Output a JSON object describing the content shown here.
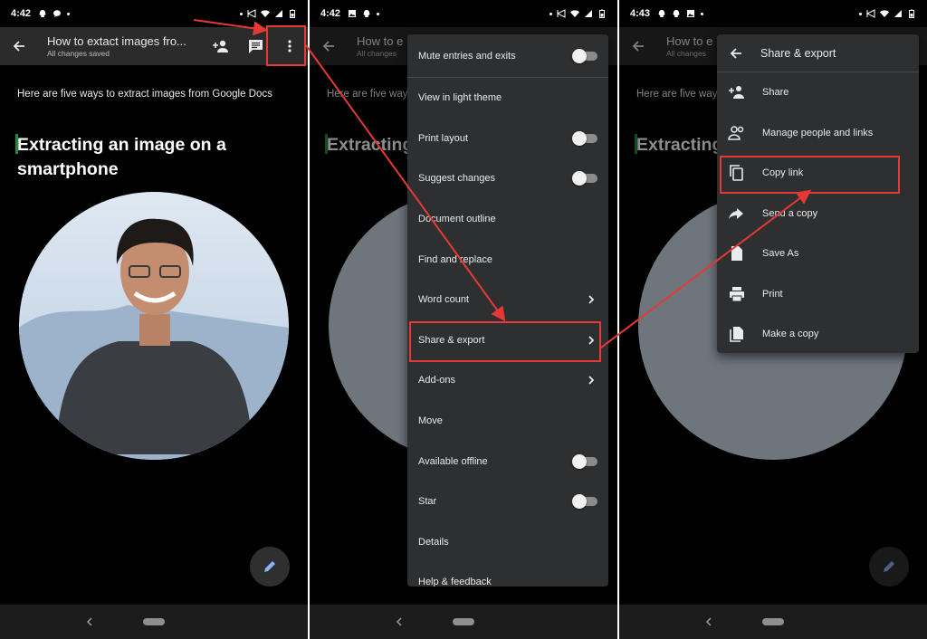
{
  "phones": [
    {
      "status": {
        "time": "4:42"
      },
      "toolbar": {
        "title": "How to extact images fro...",
        "subtitle": "All changes saved"
      },
      "doc": {
        "intro": "Here are five ways to extract images from Google Docs",
        "heading": "Extracting an image on a smartphone"
      }
    },
    {
      "status": {
        "time": "4:42"
      },
      "toolbar": {
        "title": "How to e",
        "subtitle": "All changes"
      },
      "doc": {
        "intro": "Here are five ways",
        "heading": "Extracting smartphone"
      }
    },
    {
      "status": {
        "time": "4:43"
      },
      "toolbar": {
        "title": "How to e",
        "subtitle": "All changes"
      },
      "doc": {
        "intro": "Here are five ways",
        "heading": "Extracting smartphone"
      }
    }
  ],
  "menu": {
    "items": [
      {
        "label": "Mute entries and exits",
        "control": "toggle",
        "on": false
      },
      {
        "label": "View in light theme",
        "control": "none"
      },
      {
        "label": "Print layout",
        "control": "toggle",
        "on": false
      },
      {
        "label": "Suggest changes",
        "control": "toggle",
        "on": false
      },
      {
        "label": "Document outline",
        "control": "none"
      },
      {
        "label": "Find and replace",
        "control": "none"
      },
      {
        "label": "Word count",
        "control": "chevron"
      },
      {
        "label": "Share & export",
        "control": "chevron",
        "highlighted": true
      },
      {
        "label": "Add-ons",
        "control": "chevron"
      },
      {
        "label": "Move",
        "control": "none"
      },
      {
        "label": "Available offline",
        "control": "toggle",
        "on": false
      },
      {
        "label": "Star",
        "control": "toggle",
        "on": false
      },
      {
        "label": "Details",
        "control": "none"
      },
      {
        "label": "Help & feedback",
        "control": "none"
      }
    ]
  },
  "submenu": {
    "title": "Share & export",
    "items": [
      {
        "label": "Share",
        "icon": "person-add-icon"
      },
      {
        "label": "Manage people and links",
        "icon": "people-icon"
      },
      {
        "label": "Copy link",
        "icon": "copy-icon",
        "highlighted": true
      },
      {
        "label": "Send a copy",
        "icon": "forward-arrow-icon"
      },
      {
        "label": "Save As",
        "icon": "file-icon"
      },
      {
        "label": "Print",
        "icon": "printer-icon"
      },
      {
        "label": "Make a copy",
        "icon": "copy-file-icon"
      }
    ]
  },
  "colors": {
    "accent_red": "#e53935",
    "menu_bg": "#2e2f31",
    "toolbar_bg": "#2b2b2b",
    "cursor_green": "#1e8e3e"
  }
}
